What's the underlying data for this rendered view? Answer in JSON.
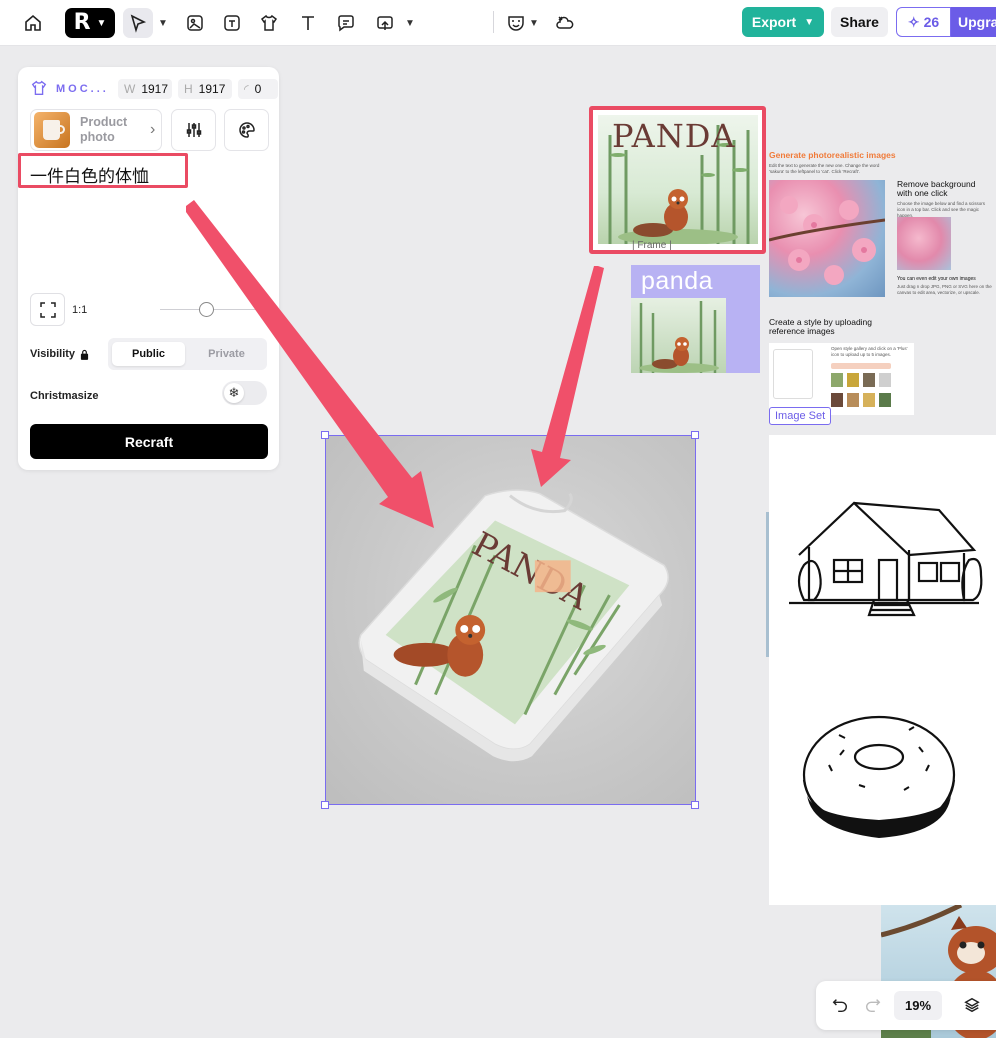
{
  "toolbar": {
    "export_label": "Export",
    "share_label": "Share",
    "credits": "26",
    "upgrade_label": "Upgra",
    "logo_text": "R"
  },
  "panel": {
    "mode_title": "MOC...",
    "width_label": "W",
    "width_value": "1917",
    "height_label": "H",
    "height_value": "1917",
    "corner_value": "0",
    "product_photo_label": "Product photo",
    "prompt_text": "一件白色的体恤",
    "aspect_ratio": "1:1",
    "visibility_label": "Visibility",
    "visibility_options": [
      "Public",
      "Private"
    ],
    "visibility_selected": "Public",
    "christmasize_label": "Christmasize",
    "christmasize_on": false,
    "recraft_button": "Recraft"
  },
  "canvas": {
    "panda_title": "PANDA",
    "panda_text": "panda",
    "frame_tag": "Frame",
    "image_set_tag": "Image Set",
    "doc": {
      "heading": "Generate photorealistic images",
      "intro": "Edit the text to generate the new one. Change the word 'sakura' to the leftpanel to 'cat'. Click 'Recraft'.",
      "remove_bg_title": "Remove background with one click",
      "remove_bg_text": "Choose the image below and find a scissors icon in a top bar. Click and see the magic happen.",
      "edit_own_text": "You can even edit your own images",
      "edit_own_sub": "Just drag n drop JPG, PNG or SVG here on the canvas to edit area, vectorize, or upscale.",
      "style_title": "Create a style by uploading reference images",
      "style_text": "Open style gallery and click on a 'Plus' icon to upload up to 5 images."
    }
  },
  "bottom_bar": {
    "zoom": "19%"
  },
  "colors": {
    "accent": "#6b5ce7",
    "export": "#21b39b",
    "highlight": "#ea4b63"
  }
}
